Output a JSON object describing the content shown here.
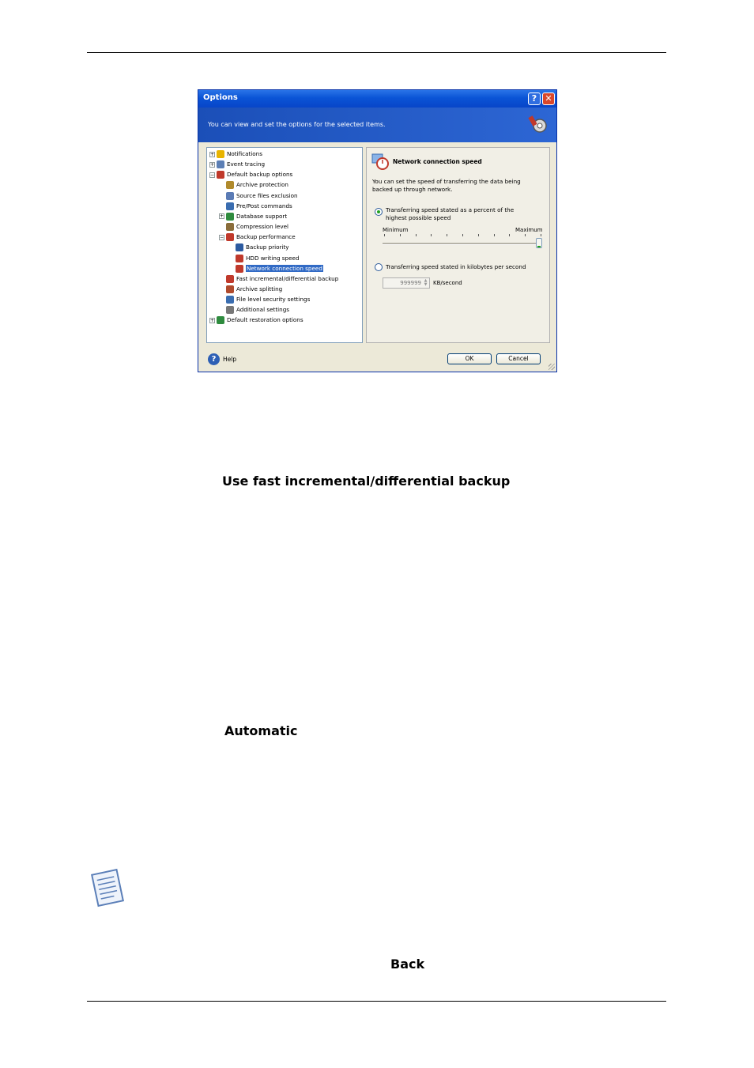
{
  "dialog": {
    "title": "Options",
    "banner_text": "You can view and set the options for the selected items.",
    "tree": [
      {
        "label": "Notifications",
        "icon": "bell-icon",
        "color": "#e8b400"
      },
      {
        "label": "Event tracing",
        "icon": "log-icon",
        "color": "#5c7fb5"
      },
      {
        "label": "Default backup options",
        "icon": "backup-options-icon",
        "color": "#c0392b"
      },
      {
        "label": "Archive protection",
        "icon": "lock-icon",
        "color": "#b08a2c"
      },
      {
        "label": "Source files exclusion",
        "icon": "filter-icon",
        "color": "#5a7bb5"
      },
      {
        "label": "Pre/Post commands",
        "icon": "command-icon",
        "color": "#3a6db0"
      },
      {
        "label": "Database support",
        "icon": "shield-icon",
        "color": "#2e8b3e"
      },
      {
        "label": "Compression level",
        "icon": "compression-icon",
        "color": "#8a6d3b"
      },
      {
        "label": "Backup performance",
        "icon": "gauge-icon",
        "color": "#c0392b"
      },
      {
        "label": "Backup priority",
        "icon": "priority-icon",
        "color": "#2c5aa0"
      },
      {
        "label": "HDD writing speed",
        "icon": "gauge-icon",
        "color": "#c0392b"
      },
      {
        "label": "Network connection speed",
        "icon": "gauge-icon",
        "color": "#c0392b"
      },
      {
        "label": "Fast incremental/differential backup",
        "icon": "fast-backup-icon",
        "color": "#c0392b"
      },
      {
        "label": "Archive splitting",
        "icon": "split-icon",
        "color": "#b04a2c"
      },
      {
        "label": "File level security settings",
        "icon": "security-icon",
        "color": "#3a6db0"
      },
      {
        "label": "Additional settings",
        "icon": "gear-icon",
        "color": "#777777"
      },
      {
        "label": "Default restoration options",
        "icon": "restore-options-icon",
        "color": "#2e8b3e"
      }
    ],
    "panel": {
      "heading": "Network connection speed",
      "description": "You can set the speed of transferring the data being backed up through network.",
      "option_percent": "Transferring speed stated as a percent of the highest possible speed",
      "slider_min_label": "Minimum",
      "slider_max_label": "Maximum",
      "slider_level_percent": 100,
      "option_kb": "Transferring speed stated in kilobytes per second",
      "kb_value": "999999",
      "kb_unit": "KB/second"
    },
    "help_label": "Help",
    "ok_label": "OK",
    "cancel_label": "Cancel"
  },
  "document": {
    "heading_fast": "Use fast incremental/differential backup",
    "heading_automatic": "Automatic",
    "word_back": "Back"
  },
  "colors": {
    "accent": "#0a54d6",
    "selection": "#316ac5"
  }
}
